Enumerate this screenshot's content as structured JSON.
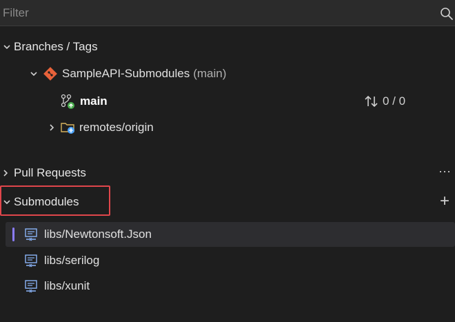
{
  "filter": {
    "placeholder": "Filter"
  },
  "branches": {
    "section_label": "Branches / Tags",
    "repo": {
      "name": "SampleAPI-Submodules",
      "branch_note": "(main)"
    },
    "current_branch": {
      "name": "main",
      "sync": "0 / 0"
    },
    "remotes": {
      "label": "remotes/origin"
    }
  },
  "pull_requests": {
    "section_label": "Pull Requests",
    "more_label": "···"
  },
  "submodules": {
    "section_label": "Submodules",
    "add_label": "+",
    "items": [
      {
        "label": "libs/Newtonsoft.Json"
      },
      {
        "label": "libs/serilog"
      },
      {
        "label": "libs/xunit"
      }
    ]
  },
  "colors": {
    "background": "#1e1e1e",
    "highlight_border": "#e0464b",
    "selection_marker": "#8b7cff",
    "git_icon": "#e8623a",
    "remote_badge": "#4aa3ff",
    "branch_badge": "#4caf50"
  }
}
